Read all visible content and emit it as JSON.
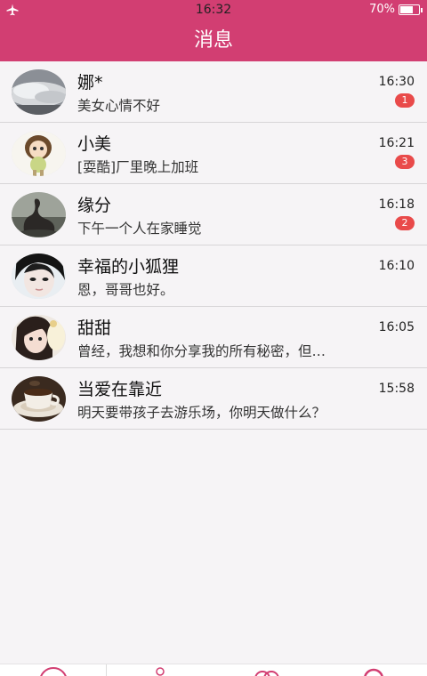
{
  "status_bar": {
    "time": "16:32",
    "battery_percent": "70%",
    "battery_level": 0.7
  },
  "header": {
    "title": "消息"
  },
  "conversations": [
    {
      "name": "娜*",
      "preview": "美女心情不好",
      "time": "16:30",
      "unread": "1"
    },
    {
      "name": "小美",
      "preview": "[耍酷]厂里晚上加班",
      "time": "16:21",
      "unread": "3"
    },
    {
      "name": "缘分",
      "preview": "下午一个人在家睡觉",
      "time": "16:18",
      "unread": "2"
    },
    {
      "name": "幸福的小狐狸",
      "preview": "恩，哥哥也好。",
      "time": "16:10",
      "unread": null
    },
    {
      "name": "甜甜",
      "preview": "曾经，我想和你分享我的所有秘密，但…",
      "time": "16:05",
      "unread": null
    },
    {
      "name": "当爱在靠近",
      "preview": "明天要带孩子去游乐场，你明天做什么？",
      "time": "15:58",
      "unread": null
    }
  ],
  "colors": {
    "accent": "#d23e72",
    "badge": "#e94a4a",
    "background": "#f6f4f6"
  },
  "icons": {
    "status_left": "airplane-icon",
    "nav": [
      "chat-icon",
      "contacts-icon",
      "moments-icon",
      "profile-icon"
    ]
  }
}
